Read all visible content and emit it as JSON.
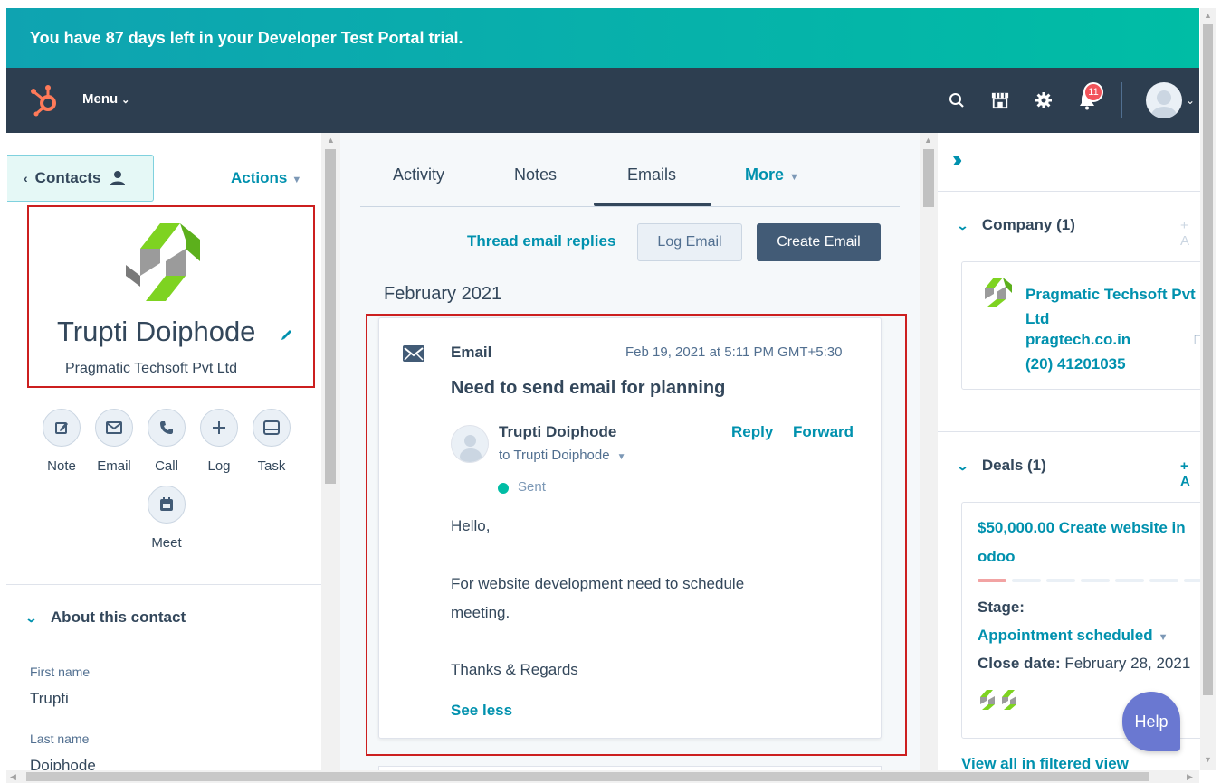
{
  "banner": {
    "text": "You have 87 days left in your Developer Test Portal trial."
  },
  "topnav": {
    "menu_label": "Menu",
    "notification_count": "11",
    "icons": [
      "hubspot-sprocket-icon",
      "search-icon",
      "marketplace-icon",
      "gear-icon",
      "notifications-icon",
      "avatar"
    ]
  },
  "left": {
    "back_label": "Contacts",
    "actions_label": "Actions",
    "contact_name": "Trupti Doiphode",
    "contact_company": "Pragmatic Techsoft Pvt Ltd",
    "quick_actions": [
      {
        "label": "Note",
        "icon": "note-icon"
      },
      {
        "label": "Email",
        "icon": "email-icon"
      },
      {
        "label": "Call",
        "icon": "call-icon"
      },
      {
        "label": "Log",
        "icon": "plus-icon"
      },
      {
        "label": "Task",
        "icon": "task-icon"
      },
      {
        "label": "Meet",
        "icon": "calendar-icon"
      }
    ],
    "about_title": "About this contact",
    "fields": [
      {
        "label": "First name",
        "value": "Trupti"
      },
      {
        "label": "Last name",
        "value": "Doiphode"
      }
    ]
  },
  "center": {
    "tabs": [
      {
        "label": "Activity"
      },
      {
        "label": "Notes"
      },
      {
        "label": "Emails",
        "active": true
      },
      {
        "label": "More"
      }
    ],
    "thread_label": "Thread email replies",
    "log_email_label": "Log Email",
    "create_email_label": "Create Email",
    "month": "February 2021",
    "email": {
      "type": "Email",
      "date": "Feb 19, 2021 at 5:11 PM GMT+5:30",
      "subject": "Need to send email for planning",
      "sender": "Trupti Doiphode",
      "to": "to Trupti Doiphode",
      "reply_label": "Reply",
      "forward_label": "Forward",
      "status": "Sent",
      "body": {
        "line1": "Hello,",
        "line2": "For website development need to schedule",
        "line3": "meeting.",
        "line4": "Thanks & Regards"
      },
      "see_less_label": "See less"
    }
  },
  "right": {
    "company_section": "Company (1)",
    "add_label": "+ A",
    "company": {
      "name_line1": "Pragmatic Techsoft Pvt",
      "name_line2": "Ltd",
      "domain": "pragtech.co.in",
      "phone": "(20) 41201035"
    },
    "deals_section": "Deals (1)",
    "deal": {
      "name_line1": "$50,000.00 Create website in",
      "name_line2": "odoo",
      "stage_label": "Stage:",
      "stage": "Appointment scheduled",
      "close_label": "Close date:",
      "close_date": "February 28, 2021",
      "progress_fraction": 0.125
    },
    "view_all_label": "View all in filtered view"
  },
  "help_label": "Help",
  "colors": {
    "banner_start": "#0fa3b1",
    "banner_end": "#00bda5",
    "nav_bg": "#2d3e50",
    "link": "#0091ae",
    "highlight_box": "#cc1f1f",
    "help_button": "#6a78d1",
    "sent_dot": "#00bda5"
  }
}
